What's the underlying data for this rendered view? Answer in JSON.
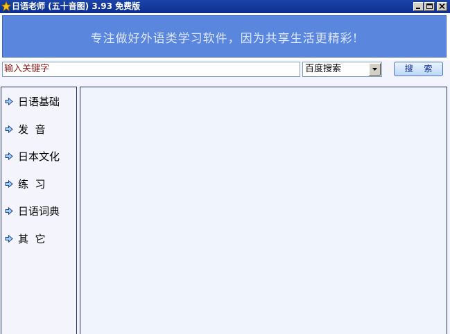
{
  "window": {
    "title": "日语老师 (五十音图) 3.93 免费版",
    "icon": "star-icon",
    "controls": [
      "minimize-icon",
      "maximize-icon",
      "close-icon"
    ]
  },
  "banner": {
    "slogan": "专注做好外语类学习软件，因为共享生活更精彩!"
  },
  "search": {
    "input_value": "输入关键字",
    "engine_selected": "百度搜索",
    "button_label": "搜 索"
  },
  "sidebar": {
    "items": [
      {
        "label": "日语基础",
        "icon": "arrow-right-icon"
      },
      {
        "label": "发  音",
        "icon": "arrow-right-icon"
      },
      {
        "label": "日本文化",
        "icon": "arrow-right-icon"
      },
      {
        "label": "练  习",
        "icon": "arrow-right-icon"
      },
      {
        "label": "日语词典",
        "icon": "arrow-right-icon"
      },
      {
        "label": "其  它",
        "icon": "arrow-right-icon"
      }
    ]
  },
  "colors": {
    "titlebar": "#0c2f91",
    "banner": "#5a86de",
    "border": "#1f2e6e"
  }
}
